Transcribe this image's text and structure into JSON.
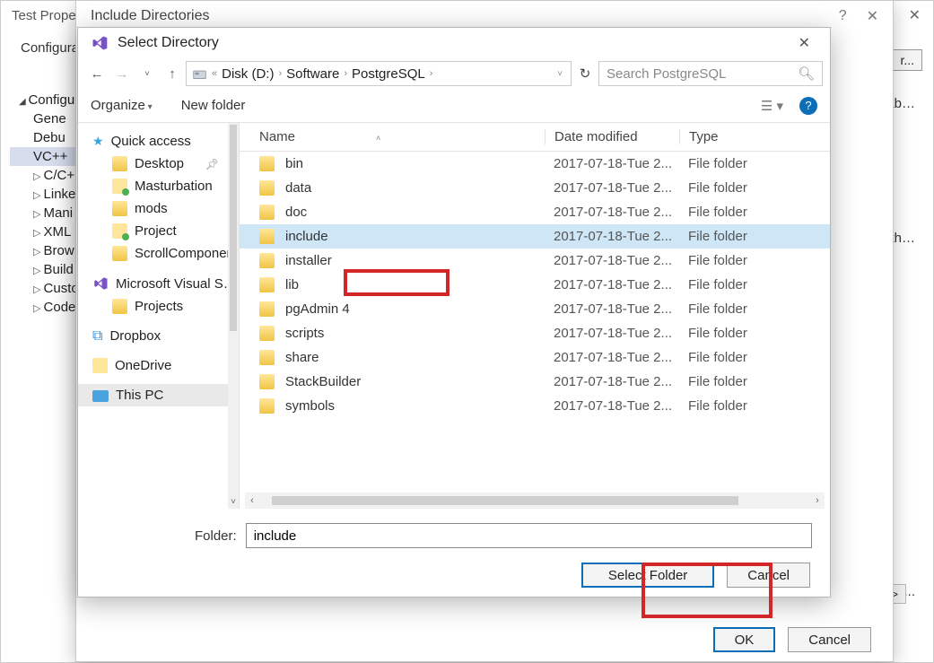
{
  "back": {
    "title": "Test Prope…",
    "config_label": "Configura",
    "mgr": "r...",
    "rtext_cut": "cutab…",
    "rtext_epath": "ePath…",
    "rtext_e2": "e ...",
    "macros": "acros>>",
    "tree": [
      {
        "label": "Configu",
        "cls": "caret-open"
      },
      {
        "label": "Gene",
        "cls": "lvl1"
      },
      {
        "label": "Debu",
        "cls": "lvl1"
      },
      {
        "label": "VC++",
        "cls": "lvl1 sel"
      },
      {
        "label": "C/C+",
        "cls": "lvl1 caret"
      },
      {
        "label": "Linke",
        "cls": "lvl1 caret"
      },
      {
        "label": "Mani",
        "cls": "lvl1 caret"
      },
      {
        "label": "XML",
        "cls": "lvl1 caret"
      },
      {
        "label": "Brow",
        "cls": "lvl1 caret"
      },
      {
        "label": "Build",
        "cls": "lvl1 caret"
      },
      {
        "label": "Custo",
        "cls": "lvl1 caret"
      },
      {
        "label": "Code",
        "cls": "lvl1 caret"
      }
    ]
  },
  "mid": {
    "title": "Include Directories",
    "help": "?",
    "close": "✕",
    "ok": "OK",
    "cancel": "Cancel"
  },
  "front": {
    "title": "Select Directory",
    "close": "✕",
    "breadcrumb": {
      "prefix": "«",
      "parts": [
        "Disk (D:)",
        "Software",
        "PostgreSQL"
      ]
    },
    "search_placeholder": "Search PostgreSQL",
    "organize": "Organize",
    "new_folder": "New folder",
    "nav_items": [
      {
        "label": "Quick access",
        "icon": "star",
        "cls": "hdr"
      },
      {
        "label": "Desktop",
        "icon": "folder",
        "cls": "sub",
        "pin": true
      },
      {
        "label": "Masturbation",
        "icon": "small-green",
        "cls": "sub"
      },
      {
        "label": "mods",
        "icon": "folder",
        "cls": "sub"
      },
      {
        "label": "Project",
        "icon": "small-green",
        "cls": "sub"
      },
      {
        "label": "ScrollComponent",
        "icon": "folder",
        "cls": "sub"
      },
      {
        "label": "Microsoft Visual S…",
        "icon": "vs",
        "cls": "hdr"
      },
      {
        "label": "Projects",
        "icon": "folder",
        "cls": "sub"
      },
      {
        "label": "Dropbox",
        "icon": "dropbox",
        "cls": "hdr"
      },
      {
        "label": "OneDrive",
        "icon": "onedrive",
        "cls": "hdr"
      },
      {
        "label": "This PC",
        "icon": "thispc",
        "cls": "hdr selected"
      }
    ],
    "columns": {
      "name": "Name",
      "date": "Date modified",
      "type": "Type"
    },
    "files": [
      {
        "name": "bin",
        "date": "2017-07-18-Tue 2...",
        "type": "File folder"
      },
      {
        "name": "data",
        "date": "2017-07-18-Tue 2...",
        "type": "File folder"
      },
      {
        "name": "doc",
        "date": "2017-07-18-Tue 2...",
        "type": "File folder"
      },
      {
        "name": "include",
        "date": "2017-07-18-Tue 2...",
        "type": "File folder",
        "selected": true
      },
      {
        "name": "installer",
        "date": "2017-07-18-Tue 2...",
        "type": "File folder"
      },
      {
        "name": "lib",
        "date": "2017-07-18-Tue 2...",
        "type": "File folder"
      },
      {
        "name": "pgAdmin 4",
        "date": "2017-07-18-Tue 2...",
        "type": "File folder"
      },
      {
        "name": "scripts",
        "date": "2017-07-18-Tue 2...",
        "type": "File folder"
      },
      {
        "name": "share",
        "date": "2017-07-18-Tue 2...",
        "type": "File folder"
      },
      {
        "name": "StackBuilder",
        "date": "2017-07-18-Tue 2...",
        "type": "File folder"
      },
      {
        "name": "symbols",
        "date": "2017-07-18-Tue 2...",
        "type": "File folder"
      }
    ],
    "folder_label": "Folder:",
    "folder_value": "include",
    "select_folder": "Select Folder",
    "cancel": "Cancel"
  }
}
